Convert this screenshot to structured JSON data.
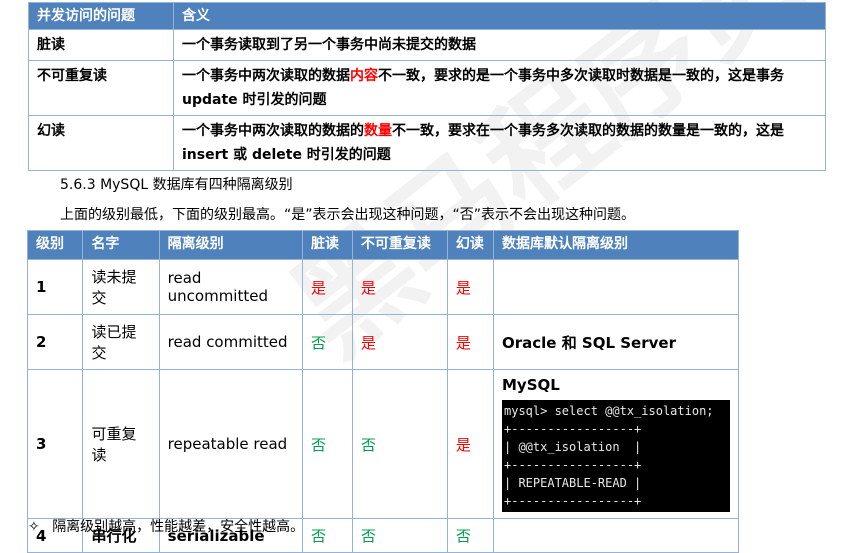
{
  "watermark": "黑马程序员 Java",
  "issues_table": {
    "headers": [
      "并发访问的问题",
      "含义"
    ],
    "rows": [
      {
        "name": "脏读",
        "desc_parts": [
          "一个事务读取到了另一个事务中尚未提交的数据"
        ]
      },
      {
        "name": "不可重复读",
        "desc_parts": [
          "一个事务中两次读取的数据",
          "内容",
          "不一致，要求的是一个事务中多次读取时数据是一致的，这是事务 update 时引发的问题"
        ]
      },
      {
        "name": "幻读",
        "desc_parts": [
          "一个事务中两次读取的数据的",
          "数量",
          "不一致，要求在一个事务多次读取的数据的数量是一致的，这是 insert 或 delete 时引发的问题"
        ]
      }
    ]
  },
  "section_caption": "5.6.3 MySQL 数据库有四种隔离级别",
  "section_note": "上面的级别最低，下面的级别最高。“是”表示会出现这种问题，“否”表示不会出现这种问题。",
  "levels_table": {
    "headers": [
      "级别",
      "名字",
      "隔离级别",
      "脏读",
      "不可重复读",
      "幻读",
      "数据库默认隔离级别"
    ],
    "rows": [
      {
        "level": "1",
        "name": "读未提交",
        "isolation": "read uncommitted",
        "dirty": "是",
        "nonrepeat": "是",
        "phantom": "是",
        "default": ""
      },
      {
        "level": "2",
        "name": "读已提交",
        "isolation": "read committed",
        "dirty": "否",
        "nonrepeat": "是",
        "phantom": "是",
        "default": "Oracle 和 SQL Server"
      },
      {
        "level": "3",
        "name": "可重复读",
        "isolation": "repeatable read",
        "dirty": "否",
        "nonrepeat": "否",
        "phantom": "是",
        "default": "MySQL"
      },
      {
        "level": "4",
        "name": "串行化",
        "isolation": "serializable",
        "dirty": "否",
        "nonrepeat": "否",
        "phantom": "否",
        "default": ""
      }
    ],
    "terminal": "mysql> select @@tx_isolation;\n+-----------------+\n| @@tx_isolation  |\n+-----------------+\n| REPEATABLE-READ |\n+-----------------+"
  },
  "bullet_icon": "diamond-bullet-icon",
  "bullet_symbol": "✧",
  "bullet_text": "隔离级别越高，性能越差，安全性越高。",
  "colors": {
    "header_bg": "#4f81bd",
    "border": "#95b3d7",
    "yes": "#ff0000",
    "no": "#00a050"
  }
}
